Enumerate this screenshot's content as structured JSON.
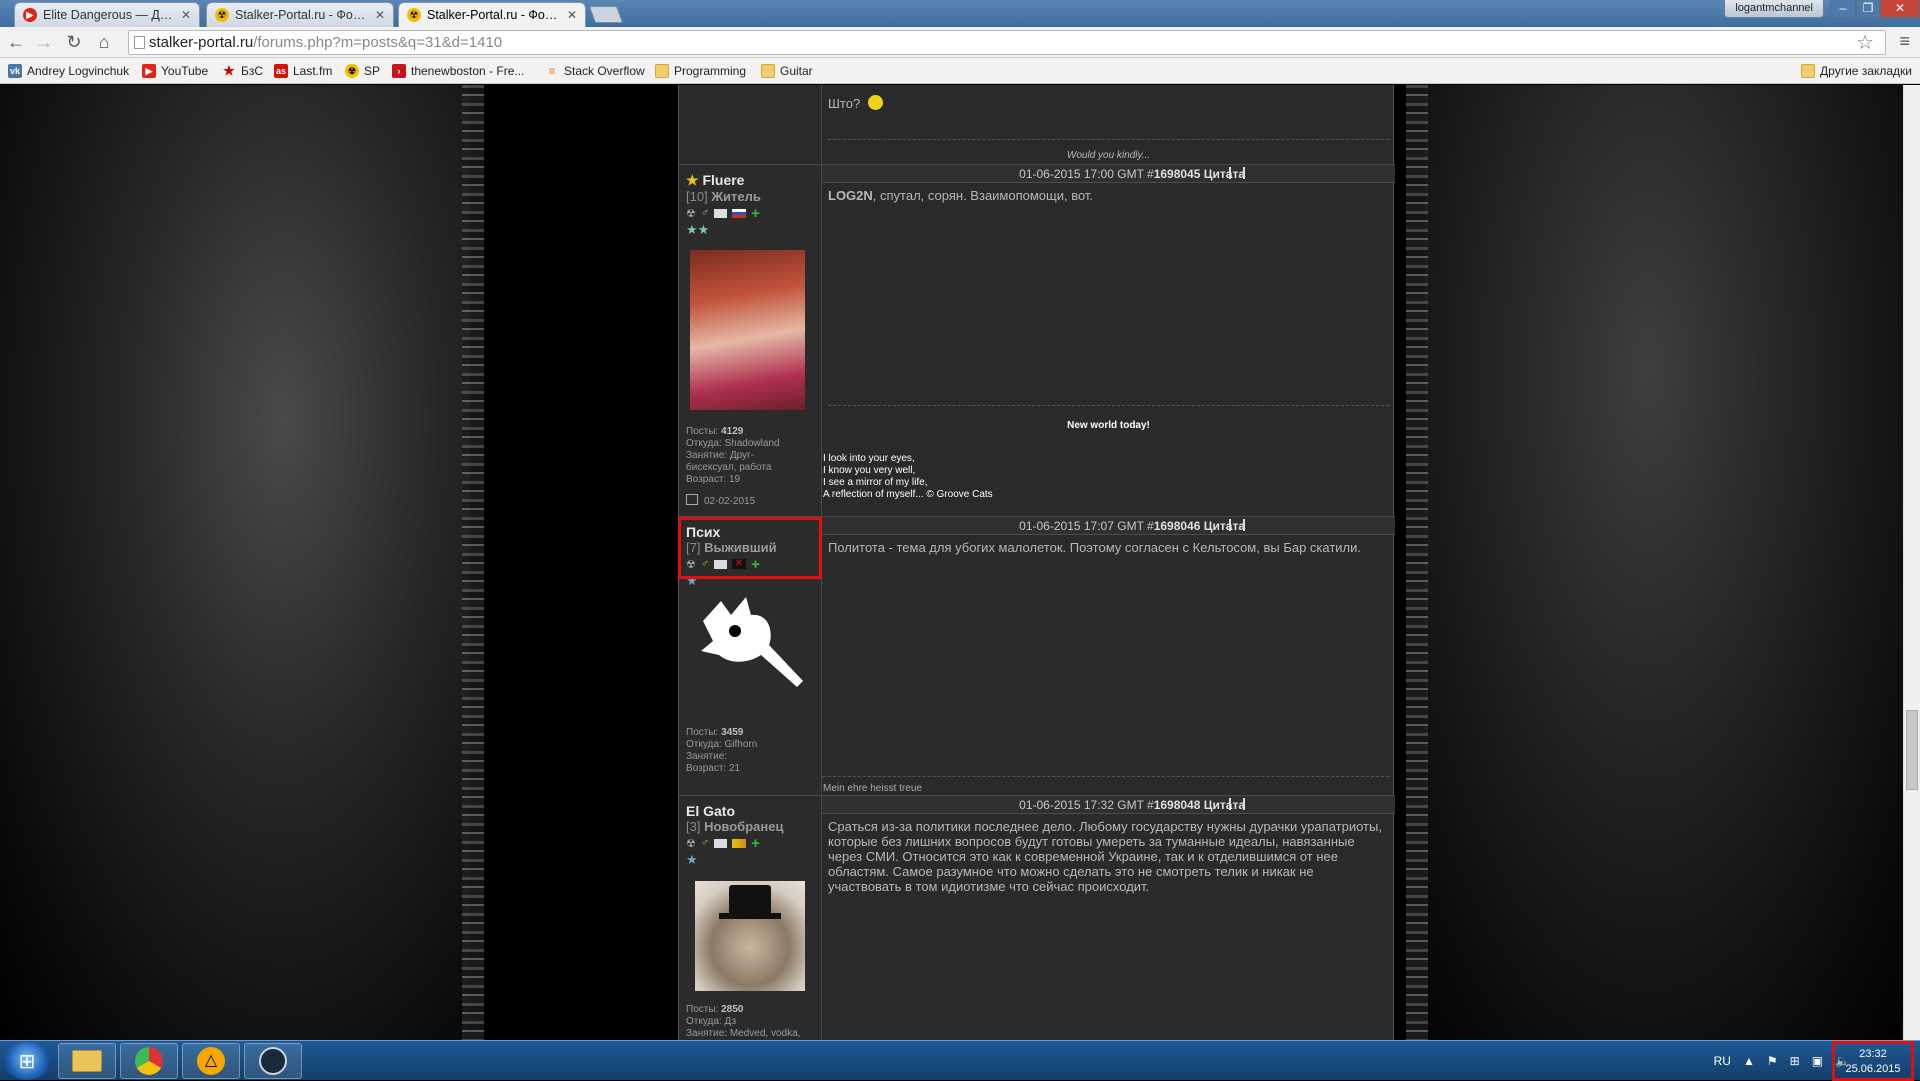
{
  "browser": {
    "tabs": [
      {
        "title": "Elite Dangerous — Дрон",
        "icon": "youtube-icon"
      },
      {
        "title": "Stalker-Portal.ru - Форум",
        "icon": "radiation-icon"
      },
      {
        "title": "Stalker-Portal.ru - Форум",
        "icon": "radiation-icon",
        "active": true
      }
    ],
    "user_badge": "logantmchannel",
    "url_host": "stalker-portal.ru",
    "url_path": "/forums.php?m=posts&q=31&d=1410",
    "bookmarks": [
      {
        "label": "Andrey Logvinchuk",
        "icon": "vk-icon"
      },
      {
        "label": "YouTube",
        "icon": "youtube-icon"
      },
      {
        "label": "БзС",
        "icon": "star-icon"
      },
      {
        "label": "Last.fm",
        "icon": "lastfm-icon"
      },
      {
        "label": "SP",
        "icon": "radiation-icon"
      },
      {
        "label": "thenewboston - Fre...",
        "icon": "thenewboston-icon"
      },
      {
        "label": "Stack Overflow",
        "icon": "stackoverflow-icon"
      },
      {
        "label": "Programming",
        "icon": "folder-icon"
      },
      {
        "label": "Guitar",
        "icon": "folder-icon"
      }
    ],
    "other_bookmarks": "Другие закладки"
  },
  "forum": {
    "top_fragment": {
      "text": "Што?",
      "signature": "Would you kindly..."
    },
    "posts": [
      {
        "username": "Fluere",
        "level": "[10]",
        "rank": "Житель",
        "header_date": "01-06-2015 17:00 GMT #",
        "post_id": "1698045",
        "quote_label": "Цитата",
        "body_bold": "LOG2N",
        "body": ", спутал, сорян. Взаимопомощи, вот.",
        "stats": {
          "posts_label": "Посты:",
          "posts": "4129",
          "from_label": "Откуда:",
          "from": "Shadowland",
          "job_label": "Занятие:",
          "job": "Друг-бисексуал, работа",
          "age_label": "Возраст:",
          "age": "19",
          "date": "02-02-2015"
        },
        "signature_title": "New world today!",
        "signature_lines": [
          "I look into your eyes,",
          "I know you very well,",
          "I see a mirror of my life,",
          "A reflection of myself... © Groove Cats"
        ]
      },
      {
        "username": "Псих",
        "level": "[7]",
        "rank": "Выживший",
        "header_date": "01-06-2015 17:07 GMT #",
        "post_id": "1698046",
        "quote_label": "Цитата",
        "body": "Политота - тема для убогих малолеток. Поэтому согласен с Кельтосом, вы Бар скатили.",
        "stats": {
          "posts_label": "Посты:",
          "posts": "3459",
          "from_label": "Откуда:",
          "from": "Gifhorn",
          "job_label": "Занятие:",
          "job": "",
          "age_label": "Возраст:",
          "age": "21"
        },
        "signature": "Mein ehre heisst treue"
      },
      {
        "username": "El Gato",
        "level": "[3]",
        "rank": "Новобранец",
        "header_date": "01-06-2015 17:32 GMT #",
        "post_id": "1698048",
        "quote_label": "Цитата",
        "body": "Сраться из-за политики последнее дело. Любому государству нужны дурачки урапатриоты, которые без лишних вопросов будут готовы умереть за туманные идеалы, навязанные через СМИ. Относится это как к современной Украине, так и к отделившимся от нее областям. Самое разумное что можно сделать это не смотреть телик и никак не участвовать в том идиотизме что сейчас происходит.",
        "stats": {
          "posts_label": "Посты:",
          "posts": "2850",
          "from_label": "Откуда:",
          "from": "Дз",
          "job_label": "Занятие:",
          "job": "Medved, vodka,"
        }
      }
    ]
  },
  "taskbar": {
    "apps": [
      "explorer-icon",
      "chrome-icon",
      "aimp-icon",
      "steam-icon"
    ],
    "lang": "RU",
    "time": "23:32",
    "date": "25.06.2015"
  }
}
